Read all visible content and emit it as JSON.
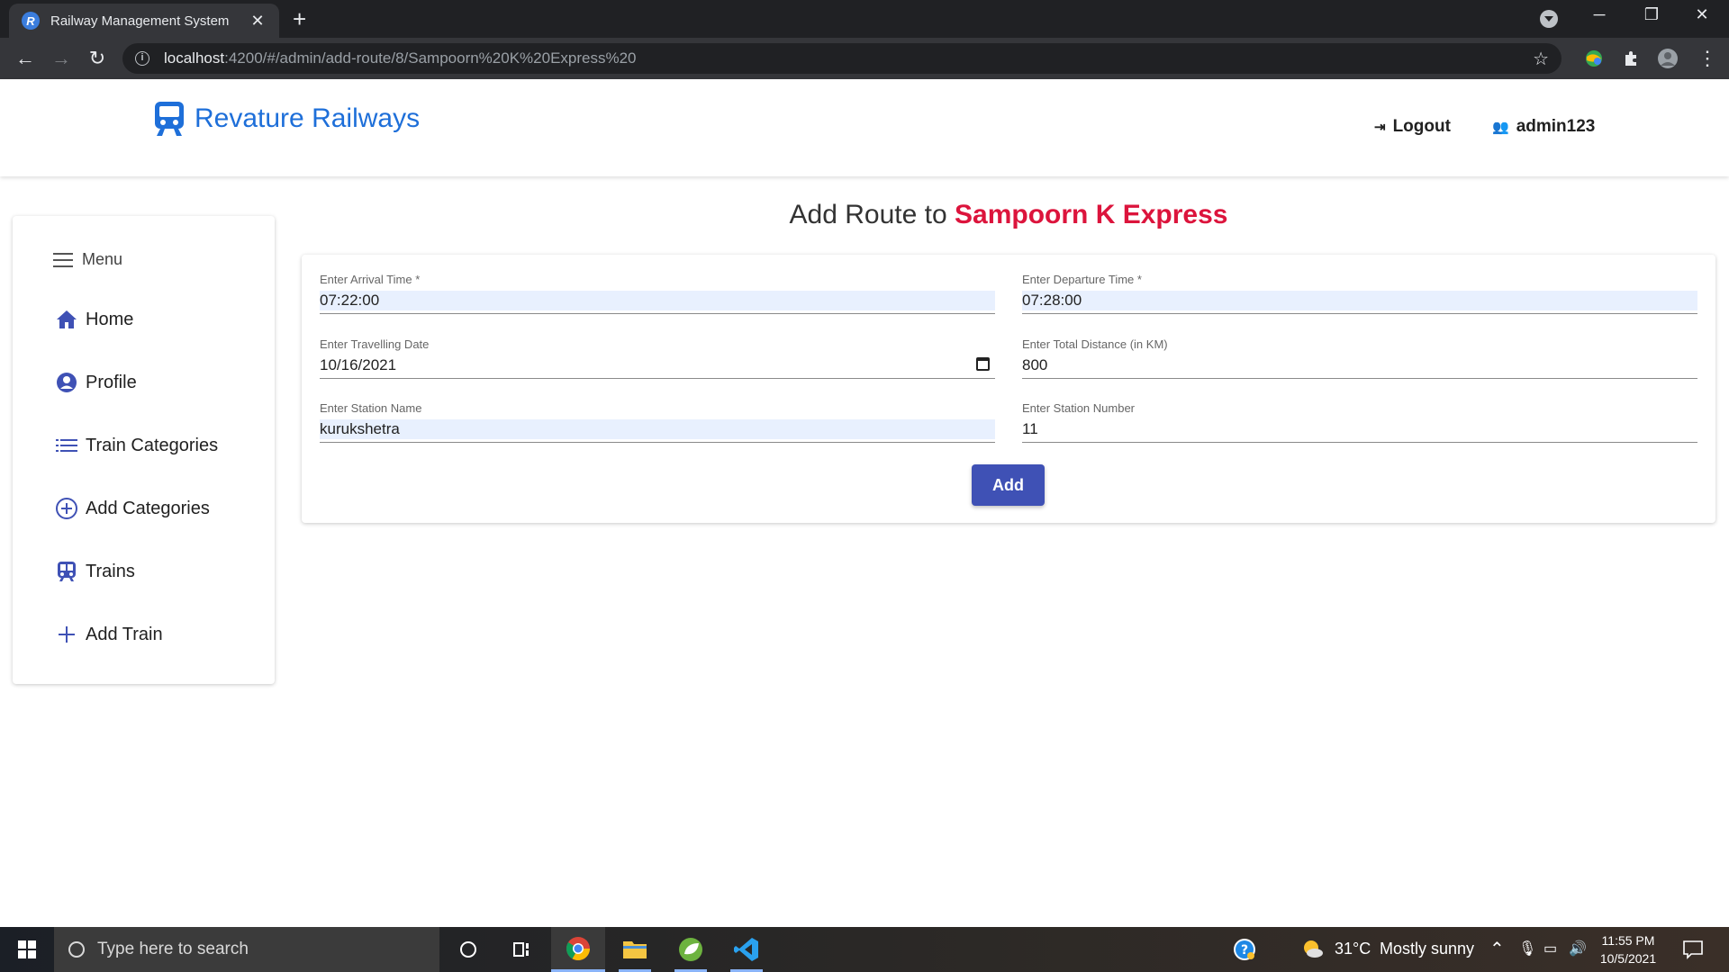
{
  "browser": {
    "tab_title": "Railway Management System",
    "tab_favicon": "R",
    "url_host": "localhost",
    "url_path": ":4200/#/admin/add-route/8/Sampoorn%20K%20Express%20",
    "new_tab_icon": "plus-icon"
  },
  "header": {
    "brand_name": "Revature Railways",
    "logout_label": "Logout",
    "user_label": "admin123"
  },
  "sidebar": {
    "menu_label": "Menu",
    "items": [
      {
        "label": "Home",
        "icon": "home-icon"
      },
      {
        "label": "Profile",
        "icon": "user-circle-icon"
      },
      {
        "label": "Train Categories",
        "icon": "list-icon"
      },
      {
        "label": "Add Categories",
        "icon": "add-circle-icon"
      },
      {
        "label": "Trains",
        "icon": "train-icon"
      },
      {
        "label": "Add Train",
        "icon": "plus-icon"
      }
    ]
  },
  "page": {
    "title_prefix": "Add Route to",
    "train_name": "Sampoorn K Express"
  },
  "form": {
    "arrival_label": "Enter Arrival Time *",
    "arrival_value": "07:22:00",
    "departure_label": "Enter Departure Time *",
    "departure_value": "07:28:00",
    "date_label": "Enter Travelling Date",
    "date_value": "10/16/2021",
    "distance_label": "Enter Total Distance (in KM)",
    "distance_value": "800",
    "station_name_label": "Enter Station Name",
    "station_name_value": "kurukshetra",
    "station_number_label": "Enter Station Number",
    "station_number_value": "11",
    "submit_label": "Add"
  },
  "taskbar": {
    "search_placeholder": "Type here to search",
    "weather_temp": "31°C",
    "weather_text": "Mostly sunny",
    "time": "11:55 PM",
    "date": "10/5/2021"
  },
  "colors": {
    "brand": "#1e6fd9",
    "accent": "#3f51b5",
    "train_name": "#dc143c"
  }
}
